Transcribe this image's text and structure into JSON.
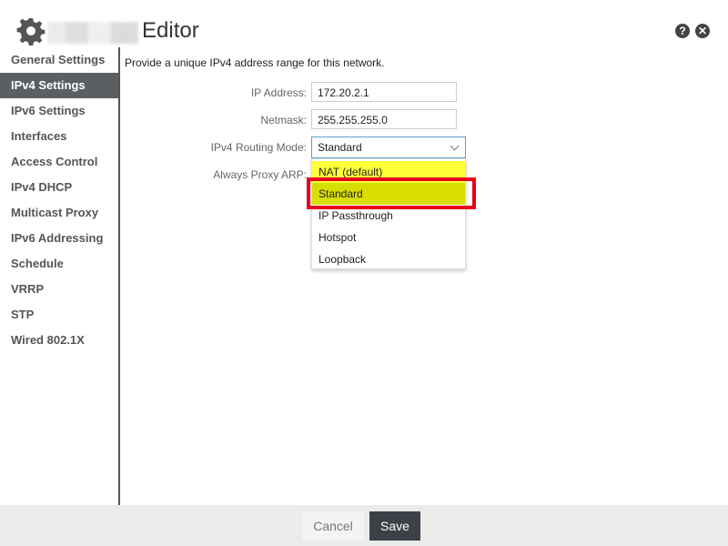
{
  "header": {
    "title": "Editor",
    "icons": [
      "gear-icon",
      "help-icon",
      "close-icon"
    ],
    "help_glyph": "?",
    "close_glyph": "✕"
  },
  "sidebar": {
    "items": [
      {
        "label": "General Settings"
      },
      {
        "label": "IPv4 Settings",
        "active": true
      },
      {
        "label": "IPv6 Settings"
      },
      {
        "label": "Interfaces"
      },
      {
        "label": "Access Control"
      },
      {
        "label": "IPv4 DHCP"
      },
      {
        "label": "Multicast Proxy"
      },
      {
        "label": "IPv6 Addressing"
      },
      {
        "label": "Schedule"
      },
      {
        "label": "VRRP"
      },
      {
        "label": "STP"
      },
      {
        "label": "Wired 802.1X"
      }
    ]
  },
  "main": {
    "intro": "Provide a unique IPv4 address range for this network.",
    "ip_address": {
      "label": "IP Address:",
      "value": "172.20.2.1"
    },
    "netmask": {
      "label": "Netmask:",
      "value": "255.255.255.0"
    },
    "routing_mode": {
      "label": "IPv4 Routing Mode:",
      "value": "Standard",
      "options": [
        "NAT (default)",
        "Standard",
        "IP Passthrough",
        "Hotspot",
        "Loopback"
      ]
    },
    "proxy_arp": {
      "label": "Always Proxy ARP:"
    }
  },
  "footer": {
    "cancel_label": "Cancel",
    "save_label": "Save"
  },
  "colors": {
    "active_sidebar": "#5a5f63",
    "highlight_yellow": "#ffff3a",
    "highlight_selected": "#d8de00",
    "annotation_red": "#e8001a",
    "save_button": "#3b4147"
  }
}
